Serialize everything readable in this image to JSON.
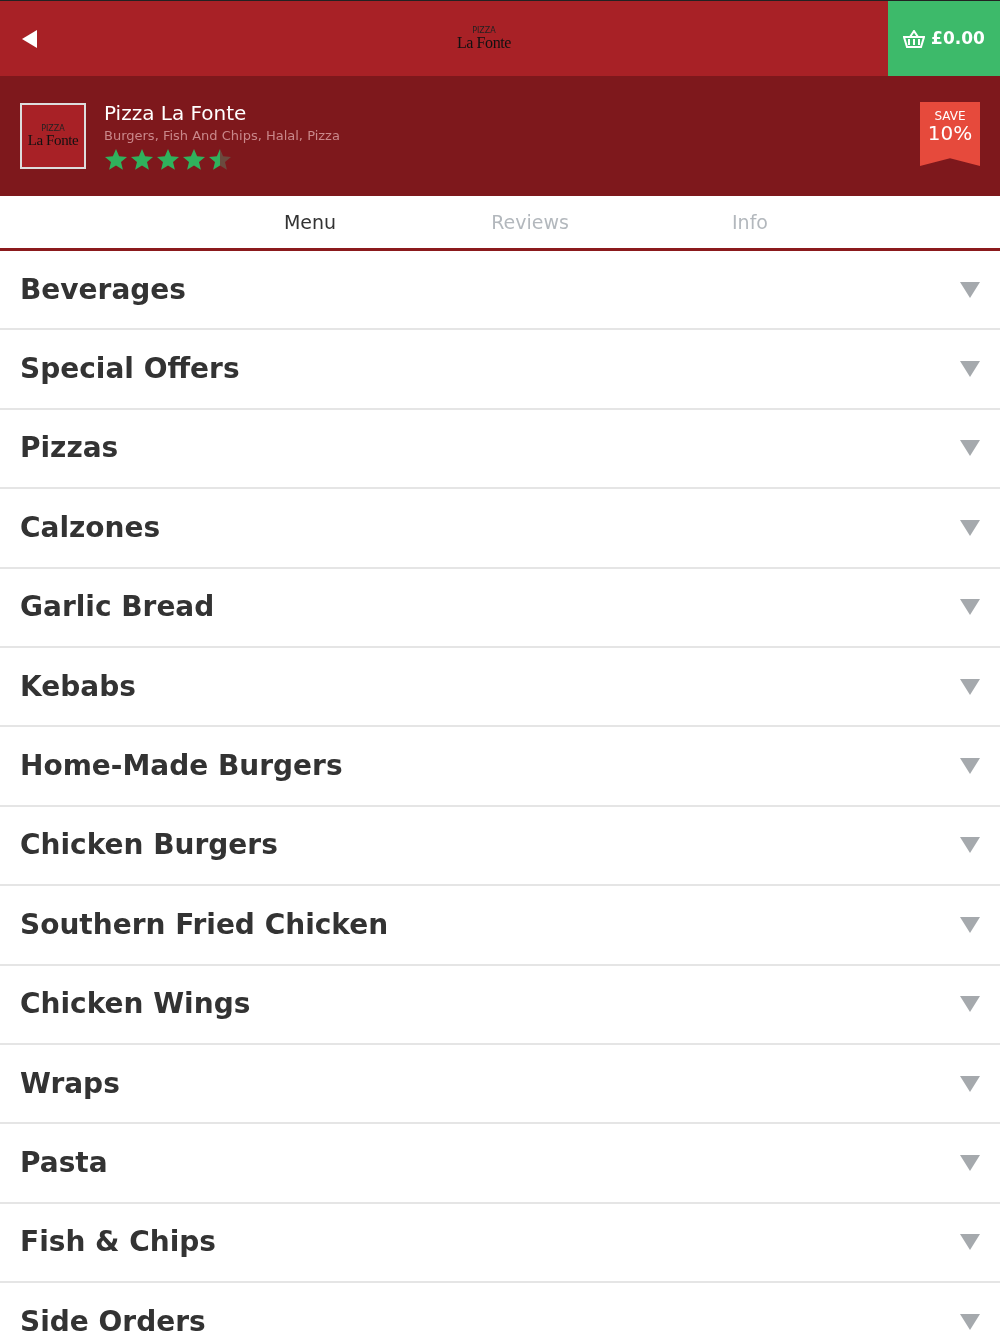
{
  "top_bar": {
    "logo": {
      "small": "PIZZA",
      "name": "La Fonte"
    },
    "basket_total": "£0.00"
  },
  "restaurant": {
    "logo": {
      "small": "PIZZA",
      "name": "La Fonte"
    },
    "name": "Pizza La Fonte",
    "cuisines": "Burgers, Fish And Chips, Halal, Pizza",
    "stars": 4.5,
    "offer": {
      "label": "SAVE",
      "value": "10%"
    }
  },
  "tabs": [
    {
      "label": "Menu",
      "selected": true
    },
    {
      "label": "Reviews",
      "selected": false
    },
    {
      "label": "Info",
      "selected": false
    }
  ],
  "categories": [
    {
      "name": "Beverages",
      "expanded": false
    },
    {
      "name": "Special Offers",
      "expanded": false
    },
    {
      "name": "Pizzas",
      "expanded": false
    },
    {
      "name": "Calzones",
      "expanded": false
    },
    {
      "name": "Garlic Bread",
      "expanded": false
    },
    {
      "name": "Kebabs",
      "expanded": false
    },
    {
      "name": "Home-Made Burgers",
      "expanded": false
    },
    {
      "name": "Chicken Burgers",
      "expanded": false
    },
    {
      "name": "Southern Fried Chicken",
      "expanded": false
    },
    {
      "name": "Chicken Wings",
      "expanded": false
    },
    {
      "name": "Wraps",
      "expanded": false
    },
    {
      "name": "Pasta",
      "expanded": false
    },
    {
      "name": "Fish & Chips",
      "expanded": false
    },
    {
      "name": "Side Orders",
      "expanded": false
    }
  ]
}
